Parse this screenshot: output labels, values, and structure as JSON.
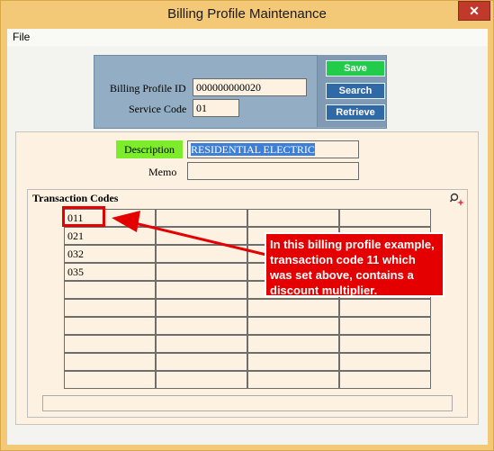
{
  "window": {
    "title": "Billing Profile Maintenance",
    "close_label": "✕"
  },
  "menu": {
    "file": "File"
  },
  "id_panel": {
    "billing_profile_id_label": "Billing Profile ID",
    "billing_profile_id_value": "000000000020",
    "service_code_label": "Service Code",
    "service_code_value": "01"
  },
  "buttons": {
    "save": "Save",
    "search": "Search",
    "retrieve": "Retrieve"
  },
  "description": {
    "label": "Description",
    "value": "RESIDENTIAL ELECTRIC",
    "memo_label": "Memo",
    "memo_value": ""
  },
  "transaction_codes": {
    "title": "Transaction Codes",
    "columns": [
      [
        "011",
        "021",
        "032",
        "035",
        "",
        "",
        "",
        "",
        "",
        ""
      ],
      [
        "",
        "",
        "",
        "",
        "",
        "",
        "",
        "",
        "",
        ""
      ],
      [
        "",
        "",
        "",
        "",
        "",
        "",
        "",
        "",
        "",
        ""
      ],
      [
        "",
        "",
        "",
        "",
        "",
        "",
        "",
        "",
        "",
        ""
      ]
    ]
  },
  "annotation": {
    "text": "In this billing profile example, transaction code 11 which was set above, contains a discount multiplier.",
    "color": "#e40000"
  }
}
